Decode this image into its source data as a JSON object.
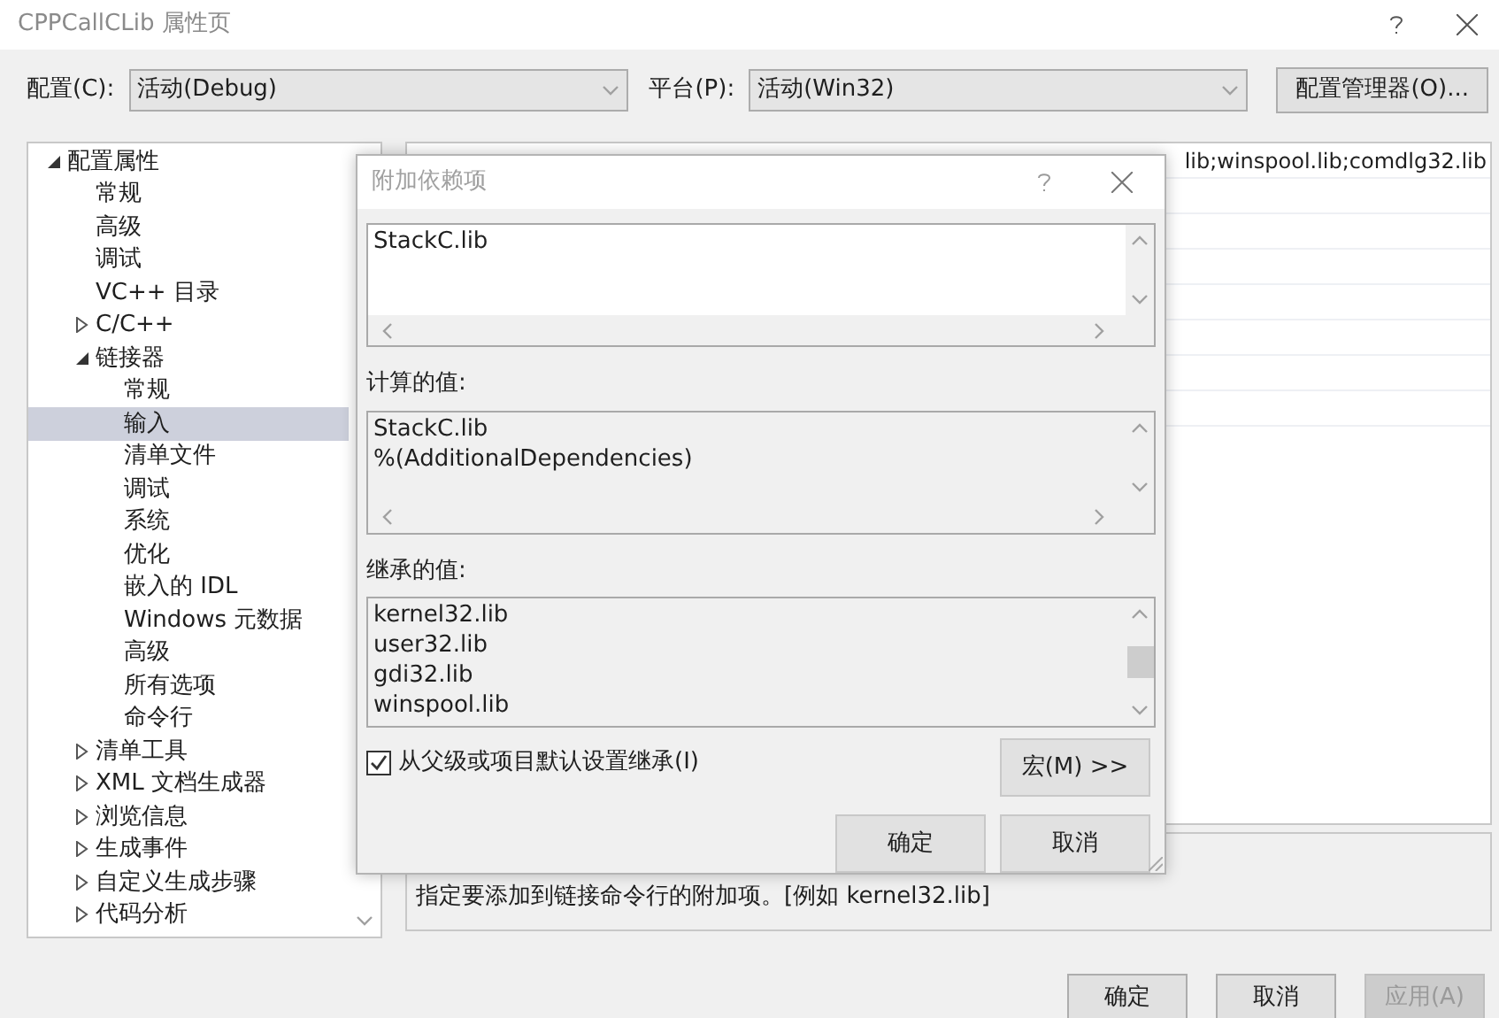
{
  "window": {
    "title": "CPPCallCLib 属性页"
  },
  "config": {
    "label": "配置(C):",
    "value": "活动(Debug)"
  },
  "platform": {
    "label": "平台(P):",
    "value": "活动(Win32)"
  },
  "config_manager_button": "配置管理器(O)...",
  "tree": [
    {
      "label": "配置属性",
      "expanded": true,
      "selected": false,
      "children": [
        {
          "label": "常规",
          "selected": false
        },
        {
          "label": "高级",
          "selected": false
        },
        {
          "label": "调试",
          "selected": false
        },
        {
          "label": "VC++ 目录",
          "selected": false
        },
        {
          "label": "C/C++",
          "expanded": false,
          "selected": false
        },
        {
          "label": "链接器",
          "expanded": true,
          "selected": false,
          "children": [
            {
              "label": "常规",
              "selected": false
            },
            {
              "label": "输入",
              "selected": true
            },
            {
              "label": "清单文件",
              "selected": false
            },
            {
              "label": "调试",
              "selected": false
            },
            {
              "label": "系统",
              "selected": false
            },
            {
              "label": "优化",
              "selected": false
            },
            {
              "label": "嵌入的 IDL",
              "selected": false
            },
            {
              "label": "Windows 元数据",
              "selected": false
            },
            {
              "label": "高级",
              "selected": false
            },
            {
              "label": "所有选项",
              "selected": false
            },
            {
              "label": "命令行",
              "selected": false
            }
          ]
        },
        {
          "label": "清单工具",
          "expanded": false,
          "selected": false
        },
        {
          "label": "XML 文档生成器",
          "expanded": false,
          "selected": false
        },
        {
          "label": "浏览信息",
          "expanded": false,
          "selected": false
        },
        {
          "label": "生成事件",
          "expanded": false,
          "selected": false
        },
        {
          "label": "自定义生成步骤",
          "expanded": false,
          "selected": false
        },
        {
          "label": "代码分析",
          "expanded": false,
          "selected": false
        }
      ]
    }
  ],
  "grid": {
    "rows": [
      {
        "value": "lib;winspool.lib;comdlg32.lib"
      }
    ]
  },
  "description": "指定要添加到链接命令行的附加项。[例如 kernel32.lib]",
  "buttons": [
    {
      "label": "确定",
      "disabled": false
    },
    {
      "label": "取消",
      "disabled": false
    },
    {
      "label": "应用(A)",
      "disabled": true
    }
  ],
  "dialog": {
    "title": "附加依赖项",
    "edit_value": "StackC.lib",
    "computed_label": "计算的值:",
    "computed_lines": [
      "StackC.lib",
      "%(AdditionalDependencies)"
    ],
    "inherited_label": "继承的值:",
    "inherited_lines": [
      "kernel32.lib",
      "user32.lib",
      "gdi32.lib",
      "winspool.lib"
    ],
    "inherit_checkbox": {
      "label": "从父级或项目默认设置继承(I)",
      "checked": true
    },
    "macro_button": "宏(M) >>",
    "ok_button": "确定",
    "cancel_button": "取消"
  }
}
